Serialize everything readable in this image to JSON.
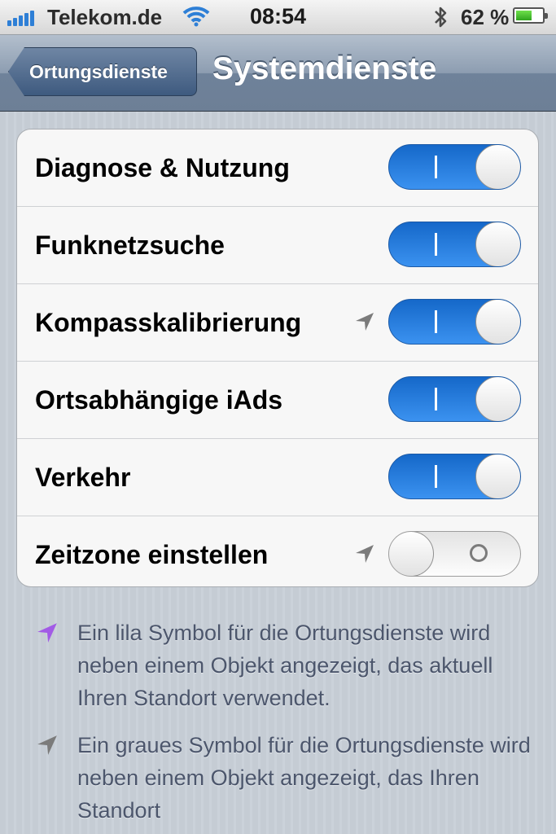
{
  "statusbar": {
    "carrier": "Telekom.de",
    "time": "08:54",
    "battery_percent": "62 %",
    "battery_level": 0.62
  },
  "navbar": {
    "back_label": "Ortungsdienste",
    "title": "Systemdienste"
  },
  "settings": {
    "rows": [
      {
        "label": "Diagnose & Nutzung",
        "on": true,
        "location_icon": false
      },
      {
        "label": "Funknetzsuche",
        "on": true,
        "location_icon": false
      },
      {
        "label": "Kompasskalibrierung",
        "on": true,
        "location_icon": true
      },
      {
        "label": "Ortsabhängige iAds",
        "on": true,
        "location_icon": false
      },
      {
        "label": "Verkehr",
        "on": true,
        "location_icon": false
      },
      {
        "label": "Zeitzone einstellen",
        "on": false,
        "location_icon": true
      }
    ]
  },
  "footnotes": {
    "purple": {
      "icon": "location-arrow-purple-icon",
      "text": "Ein lila Symbol für die Ortungsdienste wird neben einem Objekt angezeigt, das aktuell Ihren Standort verwendet."
    },
    "gray": {
      "icon": "location-arrow-gray-icon",
      "text": "Ein graues Symbol für die Ortungsdienste wird neben einem Objekt angezeigt, das Ihren Standort"
    }
  },
  "colors": {
    "switch_on": "#2f86e8",
    "purple_icon": "#a25be6",
    "gray_icon": "#7b7b7b"
  }
}
